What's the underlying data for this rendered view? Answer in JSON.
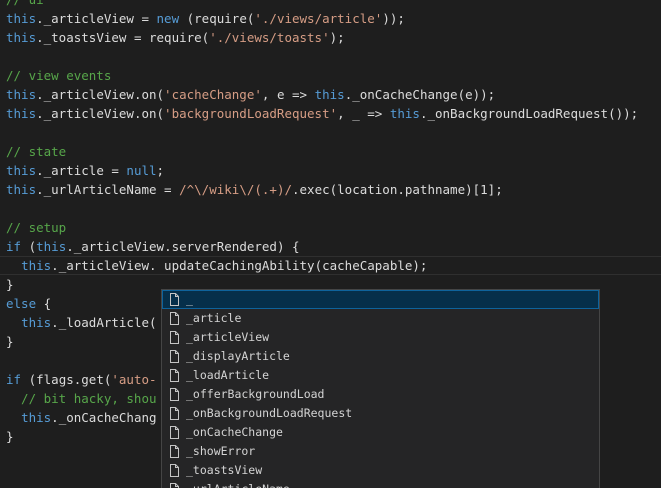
{
  "code_lines": [
    {
      "parts": [
        {
          "t": "cmt",
          "v": "// ui"
        }
      ]
    },
    {
      "parts": [
        {
          "t": "kw",
          "v": "this"
        },
        {
          "t": "txt",
          "v": "._articleView = "
        },
        {
          "t": "kw",
          "v": "new"
        },
        {
          "t": "txt",
          "v": " (require("
        },
        {
          "t": "str",
          "v": "'./views/article'"
        },
        {
          "t": "txt",
          "v": "));"
        }
      ]
    },
    {
      "parts": [
        {
          "t": "kw",
          "v": "this"
        },
        {
          "t": "txt",
          "v": "._toastsView = require("
        },
        {
          "t": "str",
          "v": "'./views/toasts'"
        },
        {
          "t": "txt",
          "v": ");"
        }
      ]
    },
    {
      "parts": []
    },
    {
      "parts": [
        {
          "t": "cmt",
          "v": "// view events"
        }
      ]
    },
    {
      "parts": [
        {
          "t": "kw",
          "v": "this"
        },
        {
          "t": "txt",
          "v": "._articleView.on("
        },
        {
          "t": "str",
          "v": "'cacheChange'"
        },
        {
          "t": "txt",
          "v": ", e => "
        },
        {
          "t": "kw",
          "v": "this"
        },
        {
          "t": "txt",
          "v": "._onCacheChange(e));"
        }
      ]
    },
    {
      "parts": [
        {
          "t": "kw",
          "v": "this"
        },
        {
          "t": "txt",
          "v": "._articleView.on("
        },
        {
          "t": "str",
          "v": "'backgroundLoadRequest'"
        },
        {
          "t": "txt",
          "v": ", _ => "
        },
        {
          "t": "kw",
          "v": "this"
        },
        {
          "t": "txt",
          "v": "._onBackgroundLoadRequest());"
        }
      ]
    },
    {
      "parts": []
    },
    {
      "parts": [
        {
          "t": "cmt",
          "v": "// state"
        }
      ]
    },
    {
      "parts": [
        {
          "t": "kw",
          "v": "this"
        },
        {
          "t": "txt",
          "v": "._article = "
        },
        {
          "t": "kw",
          "v": "null"
        },
        {
          "t": "txt",
          "v": ";"
        }
      ]
    },
    {
      "parts": [
        {
          "t": "kw",
          "v": "this"
        },
        {
          "t": "txt",
          "v": "._urlArticleName = "
        },
        {
          "t": "str",
          "v": "/^\\/wiki\\/(.+)/"
        },
        {
          "t": "txt",
          "v": ".exec(location.pathname)[1];"
        }
      ]
    },
    {
      "parts": []
    },
    {
      "parts": [
        {
          "t": "cmt",
          "v": "// setup"
        }
      ]
    },
    {
      "parts": [
        {
          "t": "kw",
          "v": "if"
        },
        {
          "t": "txt",
          "v": " ("
        },
        {
          "t": "kw",
          "v": "this"
        },
        {
          "t": "txt",
          "v": "._articleView.serverRendered) {"
        }
      ]
    },
    {
      "current": true,
      "parts": [
        {
          "t": "txt",
          "v": "  "
        },
        {
          "t": "kw",
          "v": "this"
        },
        {
          "t": "txt",
          "v": "._articleView. updateCachingAbility(cacheCapable);"
        }
      ]
    },
    {
      "parts": [
        {
          "t": "txt",
          "v": "}"
        }
      ]
    },
    {
      "parts": [
        {
          "t": "kw",
          "v": "else"
        },
        {
          "t": "txt",
          "v": " {"
        }
      ]
    },
    {
      "parts": [
        {
          "t": "txt",
          "v": "  "
        },
        {
          "t": "kw",
          "v": "this"
        },
        {
          "t": "txt",
          "v": "._loadArticle("
        }
      ]
    },
    {
      "parts": [
        {
          "t": "txt",
          "v": "}"
        }
      ]
    },
    {
      "parts": []
    },
    {
      "parts": [
        {
          "t": "kw",
          "v": "if"
        },
        {
          "t": "txt",
          "v": " (flags.get("
        },
        {
          "t": "str",
          "v": "'auto-"
        }
      ]
    },
    {
      "parts": [
        {
          "t": "cmt",
          "v": "  // bit hacky, shou"
        }
      ]
    },
    {
      "parts": [
        {
          "t": "txt",
          "v": "  "
        },
        {
          "t": "kw",
          "v": "this"
        },
        {
          "t": "txt",
          "v": "._onCacheChang"
        }
      ]
    },
    {
      "parts": [
        {
          "t": "txt",
          "v": "}"
        }
      ]
    }
  ],
  "suggestions": [
    {
      "label": "_",
      "icon": "file-icon",
      "selected": true
    },
    {
      "label": "_article",
      "icon": "file-icon"
    },
    {
      "label": "_articleView",
      "icon": "file-icon"
    },
    {
      "label": "_displayArticle",
      "icon": "file-icon"
    },
    {
      "label": "_loadArticle",
      "icon": "file-icon"
    },
    {
      "label": "_offerBackgroundLoad",
      "icon": "file-icon"
    },
    {
      "label": "_onBackgroundLoadRequest",
      "icon": "file-icon"
    },
    {
      "label": "_onCacheChange",
      "icon": "file-icon"
    },
    {
      "label": "_showError",
      "icon": "file-icon"
    },
    {
      "label": "_toastsView",
      "icon": "file-icon"
    },
    {
      "label": "_urlArticleName",
      "icon": "file-icon"
    }
  ],
  "colors": {
    "background": "#1e1e1e",
    "comment": "#57a64a",
    "keyword": "#569cd6",
    "string": "#d69d85",
    "text": "#dcdcdc",
    "suggest_bg": "#252526",
    "suggest_selected": "#062f4a"
  }
}
